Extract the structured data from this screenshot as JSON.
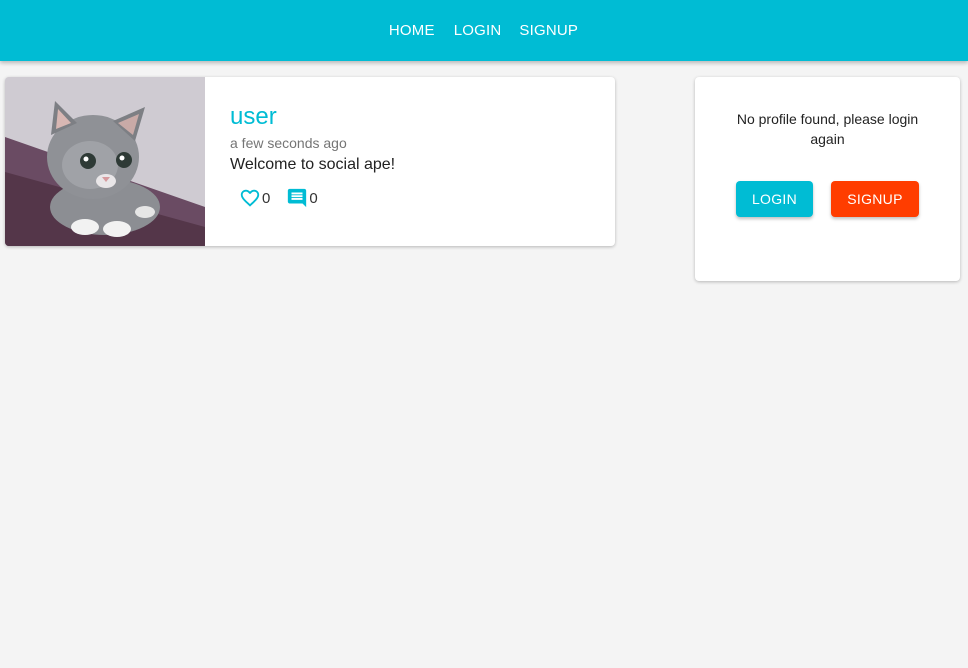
{
  "nav": {
    "home": "HOME",
    "login": "LOGIN",
    "signup": "SIGNUP"
  },
  "post": {
    "user": "user",
    "time": "a few seconds ago",
    "body": "Welcome to social ape!",
    "likes": "0",
    "comments": "0",
    "icons": {
      "like": "heart-outline-icon",
      "comment": "comment-icon"
    }
  },
  "profile": {
    "message": "No profile found, please login again",
    "login_label": "LOGIN",
    "signup_label": "SIGNUP"
  },
  "colors": {
    "primary": "#00bcd4",
    "secondary": "#ff3d00",
    "background": "#f4f4f4"
  }
}
